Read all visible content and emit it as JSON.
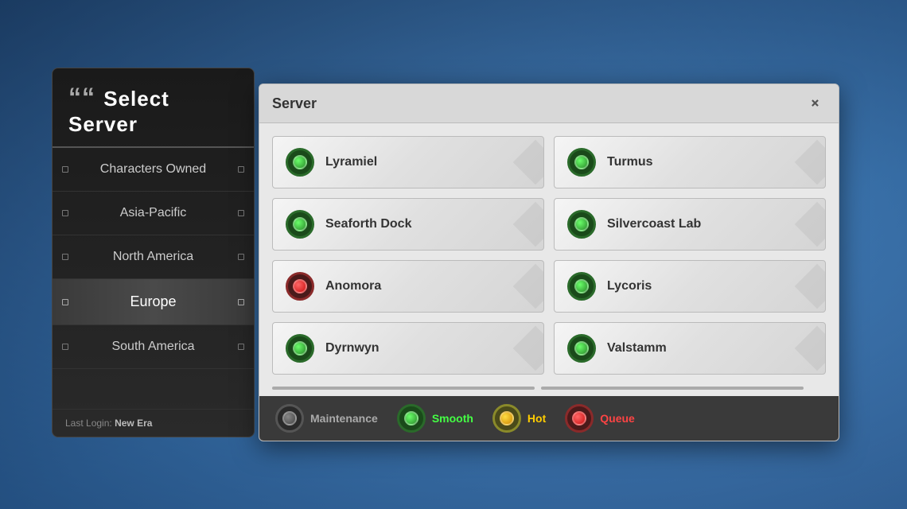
{
  "leftPanel": {
    "title": "Select Server",
    "navItems": [
      {
        "id": "characters-owned",
        "label": "Characters Owned",
        "active": false
      },
      {
        "id": "asia-pacific",
        "label": "Asia-Pacific",
        "active": false
      },
      {
        "id": "north-america",
        "label": "North America",
        "active": false
      },
      {
        "id": "europe",
        "label": "Europe",
        "active": true
      },
      {
        "id": "south-america",
        "label": "South America",
        "active": false
      }
    ],
    "lastLoginLabel": "Last Login:",
    "lastLoginValue": "New Era"
  },
  "modal": {
    "title": "Server",
    "closeLabel": "+",
    "servers": [
      {
        "id": "lyramiel",
        "name": "Lyramiel",
        "status": "smooth"
      },
      {
        "id": "turmus",
        "name": "Turmus",
        "status": "smooth"
      },
      {
        "id": "seaforth-dock",
        "name": "Seaforth Dock",
        "status": "smooth"
      },
      {
        "id": "silvercoast-lab",
        "name": "Silvercoast Lab",
        "status": "smooth"
      },
      {
        "id": "anomora",
        "name": "Anomora",
        "status": "queue"
      },
      {
        "id": "lycoris",
        "name": "Lycoris",
        "status": "smooth"
      },
      {
        "id": "dyrnwyn",
        "name": "Dyrnwyn",
        "status": "smooth"
      },
      {
        "id": "valstamm",
        "name": "Valstamm",
        "status": "smooth"
      }
    ],
    "legend": [
      {
        "id": "maintenance",
        "label": "Maintenance",
        "status": "maintenance"
      },
      {
        "id": "smooth",
        "label": "Smooth",
        "status": "smooth"
      },
      {
        "id": "hot",
        "label": "Hot",
        "status": "hot"
      },
      {
        "id": "queue",
        "label": "Queue",
        "status": "queue"
      }
    ]
  }
}
